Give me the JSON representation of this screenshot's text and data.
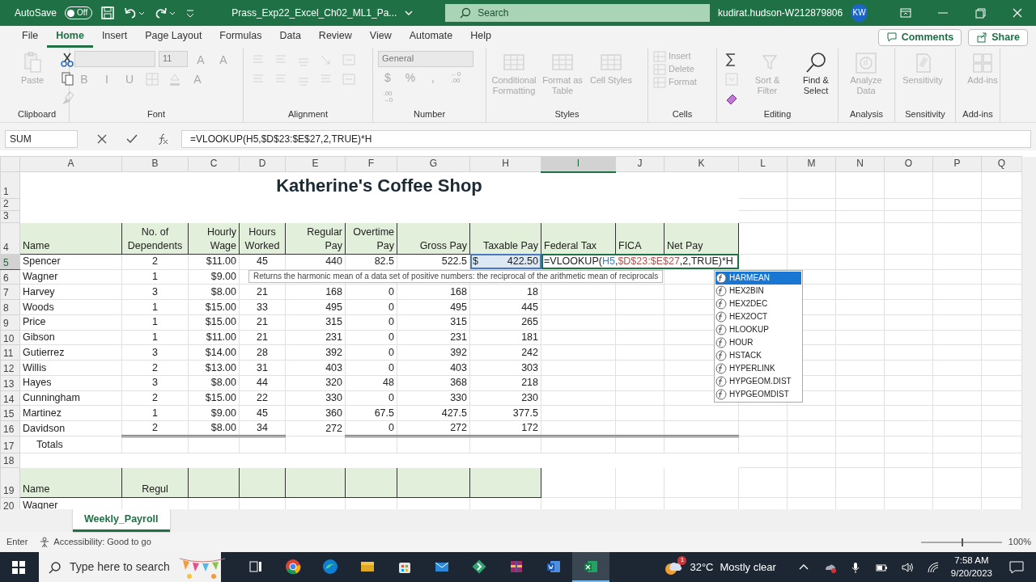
{
  "title_bar": {
    "autosave_label": "AutoSave",
    "autosave_toggle": {
      "label": "Off",
      "on": false
    },
    "file_name": "Prass_Exp22_Excel_Ch02_ML1_Pa...",
    "search": {
      "placeholder": "Search"
    },
    "user": "kudirat.hudson-W212879806",
    "avatar": "KW"
  },
  "menu_tabs": [
    {
      "label": "File",
      "selected": false
    },
    {
      "label": "Home",
      "selected": true
    },
    {
      "label": "Insert",
      "selected": false
    },
    {
      "label": "Page Layout",
      "selected": false
    },
    {
      "label": "Formulas",
      "selected": false
    },
    {
      "label": "Data",
      "selected": false
    },
    {
      "label": "Review",
      "selected": false
    },
    {
      "label": "View",
      "selected": false
    },
    {
      "label": "Automate",
      "selected": false
    },
    {
      "label": "Help",
      "selected": false
    }
  ],
  "header_buttons": [
    "Comments",
    "Share"
  ],
  "ribbon_groups": [
    {
      "label": "Clipboard",
      "items": [
        {
          "kind": "large",
          "label": "Paste",
          "disabled": true
        },
        {
          "kind": "icon",
          "disabled": false
        },
        {
          "kind": "icon",
          "disabled": false
        },
        {
          "kind": "icon",
          "disabled": true
        }
      ]
    },
    {
      "label": "Font",
      "items": [
        {
          "kind": "field",
          "disabled": true
        },
        {
          "kind": "field",
          "value": "11",
          "disabled": true
        },
        {
          "kind": "glyph",
          "label": "A",
          "disabled": true
        },
        {
          "kind": "glyph",
          "label": "A",
          "disabled": true
        },
        {
          "kind": "glyph",
          "label": "B",
          "disabled": true
        },
        {
          "kind": "glyph",
          "label": "I",
          "disabled": true
        },
        {
          "kind": "glyph",
          "label": "U",
          "disabled": true
        },
        {
          "kind": "icon",
          "disabled": true
        },
        {
          "kind": "icon",
          "disabled": true
        },
        {
          "kind": "glyph",
          "label": "A",
          "disabled": true
        }
      ]
    },
    {
      "label": "Alignment",
      "items": [
        {
          "kind": "icon",
          "disabled": true
        },
        {
          "kind": "icon",
          "disabled": true
        },
        {
          "kind": "icon",
          "disabled": true
        },
        {
          "kind": "icon",
          "disabled": true
        },
        {
          "kind": "icon",
          "disabled": true
        },
        {
          "kind": "icon",
          "disabled": true
        },
        {
          "kind": "icon",
          "disabled": true
        },
        {
          "kind": "icon",
          "disabled": true
        },
        {
          "kind": "icon",
          "disabled": true
        },
        {
          "kind": "icon",
          "disabled": true
        }
      ]
    },
    {
      "label": "Number",
      "items": [
        {
          "kind": "field",
          "value": "General",
          "disabled": true
        },
        {
          "kind": "glyph",
          "label": "$",
          "disabled": true
        },
        {
          "kind": "glyph",
          "label": "%",
          "disabled": true
        },
        {
          "kind": "glyph",
          "label": ",",
          "disabled": true
        },
        {
          "kind": "glyph2",
          "top": "←0",
          "bottom": ".00",
          "disabled": true
        },
        {
          "kind": "glyph2",
          "top": ".00",
          "bottom": "→0",
          "disabled": true
        }
      ]
    },
    {
      "label": "Styles",
      "items": [
        {
          "kind": "large",
          "label": "Conditional Formatting",
          "disabled": true
        },
        {
          "kind": "large",
          "label": "Format as Table",
          "disabled": true
        },
        {
          "kind": "large",
          "label": "Cell Styles",
          "disabled": true
        }
      ]
    },
    {
      "label": "Cells",
      "items": [
        {
          "kind": "small",
          "label": "Insert",
          "disabled": true
        },
        {
          "kind": "small",
          "label": "Delete",
          "disabled": true
        },
        {
          "kind": "small",
          "label": "Format",
          "disabled": true
        }
      ]
    },
    {
      "label": "Editing",
      "items": [
        {
          "kind": "icon",
          "disabled": false
        },
        {
          "kind": "icon",
          "disabled": true
        },
        {
          "kind": "icon",
          "disabled": false
        },
        {
          "kind": "large",
          "label": "Sort & Filter",
          "disabled": true
        },
        {
          "kind": "large",
          "label": "Find & Select",
          "disabled": false
        }
      ]
    },
    {
      "label": "Analysis",
      "items": [
        {
          "kind": "large",
          "label": "Analyze Data",
          "disabled": true
        }
      ]
    },
    {
      "label": "Sensitivity",
      "items": [
        {
          "kind": "large",
          "label": "Sensitivity",
          "disabled": true
        }
      ]
    },
    {
      "label": "Add-ins",
      "items": [
        {
          "kind": "large",
          "label": "Add-ins",
          "disabled": true
        }
      ]
    }
  ],
  "name_box": "SUM",
  "formula": "=VLOOKUP(H5,$D$23:$E$27,2,TRUE)*H",
  "columns": [
    {
      "label": "A",
      "selected": false
    },
    {
      "label": "B",
      "selected": false
    },
    {
      "label": "C",
      "selected": false
    },
    {
      "label": "D",
      "selected": false
    },
    {
      "label": "E",
      "selected": false
    },
    {
      "label": "F",
      "selected": false
    },
    {
      "label": "G",
      "selected": false
    },
    {
      "label": "H",
      "selected": false
    },
    {
      "label": "I",
      "selected": true
    },
    {
      "label": "J",
      "selected": false
    },
    {
      "label": "K",
      "selected": false
    },
    {
      "label": "L",
      "selected": false
    },
    {
      "label": "M",
      "selected": false
    },
    {
      "label": "N",
      "selected": false
    },
    {
      "label": "O",
      "selected": false
    },
    {
      "label": "P",
      "selected": false
    },
    {
      "label": "Q",
      "selected": false
    }
  ],
  "rows": [
    {
      "number": "1",
      "selected": false,
      "kind": "title",
      "cells": [
        "Katherine's Coffee Shop"
      ]
    },
    {
      "number": "2",
      "selected": false,
      "kind": "blank",
      "cells": []
    },
    {
      "number": "3",
      "selected": false,
      "kind": "blank",
      "cells": []
    },
    {
      "number": "4",
      "selected": false,
      "kind": "header",
      "cells": [
        "Name",
        "No. of Dependents",
        "Hourly Wage",
        "Hours Worked",
        "Regular Pay",
        "Overtime Pay",
        "Gross Pay",
        "Taxable Pay",
        "Federal Tax",
        "FICA",
        "Net Pay"
      ]
    },
    {
      "number": "5",
      "selected": true,
      "kind": "data",
      "cells": [
        "Spencer",
        "2",
        "$11.00",
        "45",
        "440",
        "82.5",
        "522.5",
        {
          "symbol": "$",
          "value": "422.50",
          "referenced": true
        },
        {
          "parts": [
            {
              "text": "=VLOOKUP("
            },
            {
              "text": "H5",
              "color": "#3c7fc0"
            },
            {
              "text": ","
            },
            {
              "text": "$D$23:$E$27",
              "color": "#b2524c"
            },
            {
              "text": ",2,TRUE)*H"
            }
          ]
        }
      ]
    },
    {
      "number": "6",
      "selected": false,
      "kind": "data",
      "cells": [
        "Wagner",
        "1",
        "$9.00"
      ]
    },
    {
      "number": "7",
      "selected": false,
      "kind": "data",
      "cells": [
        "Harvey",
        "3",
        "$8.00",
        "21",
        "168",
        "0",
        "168",
        "18"
      ]
    },
    {
      "number": "8",
      "selected": false,
      "kind": "data",
      "cells": [
        "Woods",
        "1",
        "$15.00",
        "33",
        "495",
        "0",
        "495",
        "445"
      ]
    },
    {
      "number": "9",
      "selected": false,
      "kind": "data",
      "cells": [
        "Price",
        "1",
        "$15.00",
        "21",
        "315",
        "0",
        "315",
        "265"
      ]
    },
    {
      "number": "10",
      "selected": false,
      "kind": "data",
      "cells": [
        "Gibson",
        "1",
        "$11.00",
        "21",
        "231",
        "0",
        "231",
        "181"
      ]
    },
    {
      "number": "11",
      "selected": false,
      "kind": "data",
      "cells": [
        "Gutierrez",
        "3",
        "$14.00",
        "28",
        "392",
        "0",
        "392",
        "242"
      ]
    },
    {
      "number": "12",
      "selected": false,
      "kind": "data",
      "cells": [
        "Willis",
        "2",
        "$13.00",
        "31",
        "403",
        "0",
        "403",
        "303"
      ]
    },
    {
      "number": "13",
      "selected": false,
      "kind": "data",
      "cells": [
        "Hayes",
        "3",
        "$8.00",
        "44",
        "320",
        "48",
        "368",
        "218"
      ]
    },
    {
      "number": "14",
      "selected": false,
      "kind": "data",
      "cells": [
        "Cunningham",
        "2",
        "$15.00",
        "22",
        "330",
        "0",
        "330",
        "230"
      ]
    },
    {
      "number": "15",
      "selected": false,
      "kind": "data",
      "cells": [
        "Martinez",
        "1",
        "$9.00",
        "45",
        "360",
        "67.5",
        "427.5",
        "377.5"
      ]
    },
    {
      "number": "16",
      "selected": false,
      "kind": "last",
      "cells": [
        "Davidson",
        "2",
        "$8.00",
        "34",
        "272",
        "0",
        "272",
        "172"
      ]
    },
    {
      "number": "17",
      "selected": false,
      "kind": "totals",
      "cells": [
        "Totals"
      ]
    },
    {
      "number": "18",
      "selected": false,
      "kind": "blank",
      "cells": []
    },
    {
      "number": "19",
      "selected": false,
      "kind": "subheader",
      "cells": [
        "Name",
        "Regul"
      ]
    },
    {
      "number": "20",
      "selected": false,
      "kind": "data",
      "cells": [
        "Wagner"
      ]
    }
  ],
  "tooltip": "Returns the harmonic mean of a data set of positive numbers: the reciprocal of the arithmetic mean of reciprocals",
  "autocomplete": [
    {
      "label": "HARMEAN",
      "selected": true
    },
    {
      "label": "HEX2BIN",
      "selected": false
    },
    {
      "label": "HEX2DEC",
      "selected": false
    },
    {
      "label": "HEX2OCT",
      "selected": false
    },
    {
      "label": "HLOOKUP",
      "selected": false
    },
    {
      "label": "HOUR",
      "selected": false
    },
    {
      "label": "HSTACK",
      "selected": false
    },
    {
      "label": "HYPERLINK",
      "selected": false
    },
    {
      "label": "HYPGEOM.DIST",
      "selected": false
    },
    {
      "label": "HYPGEOMDIST",
      "selected": false
    }
  ],
  "sheet_tabs": [
    {
      "label": "Weekly_Payroll",
      "selected": true
    }
  ],
  "status_bar": {
    "mode": "Enter",
    "accessibility": "Accessibility: Good to go",
    "zoom": {
      "level": 0.5,
      "reading": "100%"
    }
  },
  "taskbar": {
    "search": {
      "placeholder": "Type here to search"
    },
    "apps": [
      {
        "selected": false
      },
      {
        "selected": false
      },
      {
        "selected": false
      },
      {
        "selected": false
      },
      {
        "selected": false
      },
      {
        "selected": false
      },
      {
        "selected": false
      },
      {
        "selected": false
      },
      {
        "selected": false
      },
      {
        "selected": true
      }
    ],
    "weather": {
      "temperature": "32°C",
      "condition": "Mostly clear",
      "badge": "1"
    },
    "time": "7:58 AM",
    "date": "9/20/2023"
  }
}
